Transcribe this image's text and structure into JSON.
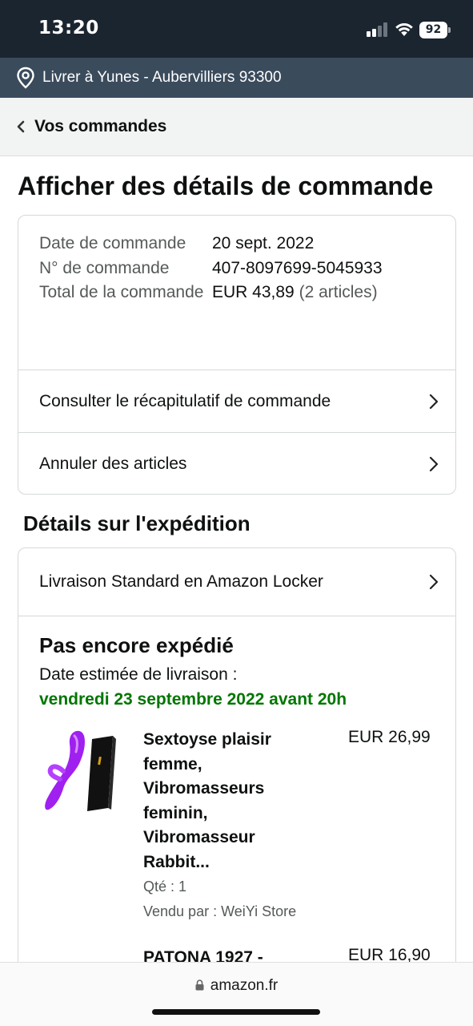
{
  "status_bar": {
    "time": "13:20",
    "battery": "92"
  },
  "delivery_bar": {
    "text": "Livrer à Yunes - Aubervilliers 93300"
  },
  "back_nav": {
    "label": "Vos commandes"
  },
  "page_title": "Afficher des détails de commande",
  "order_summary": {
    "date_label": "Date de commande",
    "date_value": "20 sept. 2022",
    "number_label": "N° de commande",
    "number_value": "407-8097699-5045933",
    "total_label": "Total de la commande",
    "total_value": "EUR 43,89",
    "total_items": "(2 articles)",
    "links": {
      "recap": "Consulter le récapitulatif de commande",
      "cancel": "Annuler des articles"
    }
  },
  "shipping": {
    "section_title": "Détails sur l'expédition",
    "method": "Livraison Standard en Amazon Locker",
    "status": "Pas encore expédié",
    "estimate_label": "Date estimée de livraison :",
    "estimate_date": "vendredi 23 septembre 2022 avant 20h",
    "items": [
      {
        "title": "Sextoyse plaisir femme, Vibromasseurs feminin, Vibromasseur Rabbit...",
        "price": "EUR 26,99",
        "qty": "Qté : 1",
        "seller": "Vendu par : WeiYi Store"
      },
      {
        "title": "PATONA 1927 -",
        "price": "EUR 16,90"
      }
    ]
  },
  "browser": {
    "url": "amazon.fr"
  },
  "colors": {
    "status_bg": "#1b2530",
    "deliver_bg": "#3a4b5c",
    "estimate_green": "#007600",
    "purple_product": "#a020f0"
  }
}
